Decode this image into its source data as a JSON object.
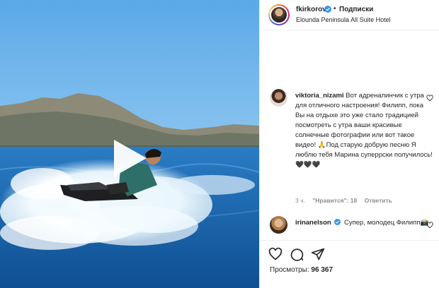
{
  "post": {
    "username": "fkirkorov",
    "follow_label": "Подписки",
    "separator": "•",
    "location": "Elounda Peninsula All Suite Hotel"
  },
  "comments": [
    {
      "username": "viktoria_nizami",
      "text": "Вот адреналинчик с утра для отличного настроения! Филипп, пока Вы на отдыхе это уже стало традицией посмотреть с утра ваши красивые солнечные фотографии или вот такое видео! 🙏Под старую добрую песню Я люблю тебя Марина суперрски получилось! 🖤🖤🖤",
      "time": "3 ч.",
      "likes": "\"Нравится\": 18",
      "reply": "Ответить"
    },
    {
      "username": "irinanelson",
      "text": "Супер, молодец Филипп📸"
    }
  ],
  "stats": {
    "views_label": "Просмотры:",
    "views_value": "96 367"
  },
  "icons": {
    "verified": "verified-badge-icon",
    "like": "heart-icon",
    "comment": "comment-icon",
    "share": "share-icon",
    "play": "play-icon"
  },
  "colors": {
    "verified_blue": "#3897f0",
    "sky": "#7fc0ec",
    "sea": "#1f6fb8"
  }
}
